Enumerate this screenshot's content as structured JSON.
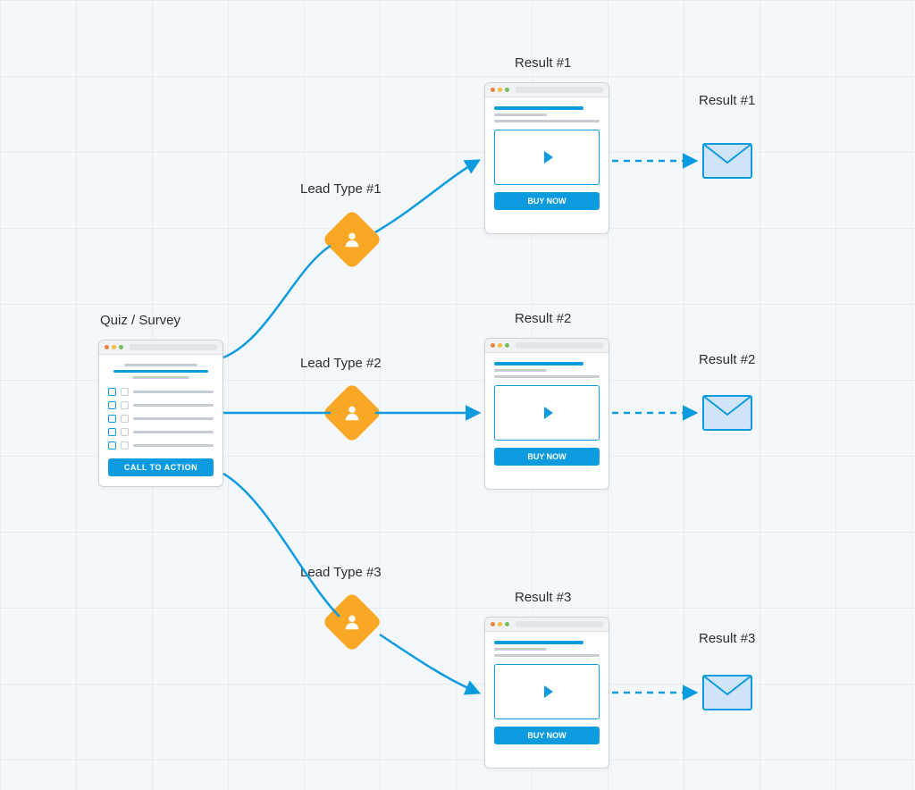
{
  "quiz": {
    "title": "Quiz / Survey",
    "cta_label": "CALL TO ACTION"
  },
  "leads": [
    {
      "label": "Lead Type #1"
    },
    {
      "label": "Lead Type #2"
    },
    {
      "label": "Lead Type #3"
    }
  ],
  "results": [
    {
      "title": "Result #1",
      "buy_label": "BUY NOW",
      "email_title": "Result #1"
    },
    {
      "title": "Result #2",
      "buy_label": "BUY NOW",
      "email_title": "Result #2"
    },
    {
      "title": "Result #3",
      "buy_label": "BUY NOW",
      "email_title": "Result #3"
    }
  ],
  "colors": {
    "accent": "#0d9be0",
    "diamond": "#f9a825",
    "envelope_fill": "#cfe5f7",
    "envelope_stroke": "#0d9be0"
  }
}
